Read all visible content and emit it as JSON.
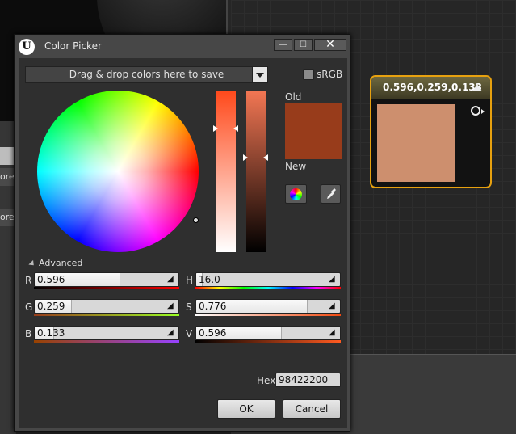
{
  "background": {
    "left_strips": [
      "",
      "ores",
      "ores"
    ]
  },
  "node": {
    "title": "0.596,0.259,0.133",
    "preview_color": "#cd8f6e"
  },
  "dialog": {
    "title": "Color Picker",
    "window_buttons": {
      "minimize": "—",
      "maximize": "☐",
      "close": "✕"
    },
    "drop_area_label": "Drag & drop colors here to save",
    "srgb_label": "sRGB",
    "old_label": "Old",
    "new_label": "New",
    "old_color": "#983c1b",
    "advanced_label": "Advanced",
    "fields": {
      "r": {
        "label": "R",
        "value": "0.596",
        "level": 0.596
      },
      "g": {
        "label": "G",
        "value": "0.259",
        "level": 0.259
      },
      "b": {
        "label": "B",
        "value": "0.133",
        "level": 0.133
      },
      "h": {
        "label": "H",
        "value": "16.0",
        "level": 0.044
      },
      "s": {
        "label": "S",
        "value": "0.776",
        "level": 0.776
      },
      "v": {
        "label": "V",
        "value": "0.596",
        "level": 0.596
      }
    },
    "hex_label": "Hex",
    "hex_value": "98422200",
    "ok_label": "OK",
    "cancel_label": "Cancel"
  }
}
